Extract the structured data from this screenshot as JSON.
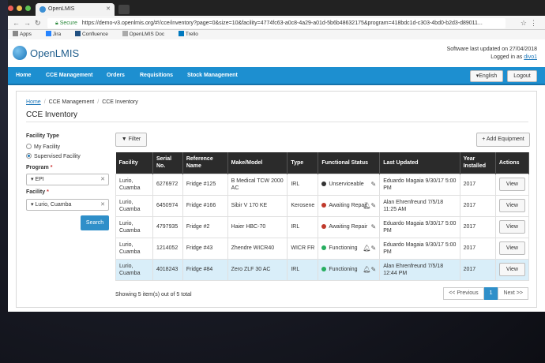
{
  "browser": {
    "tab_title": "OpenLMIS",
    "secure_label": "Secure",
    "url": "https://demo-v3.openlmis.org/#!/cce/inventory?page=0&size=10&facility=4774fc63-a0c8-4a29-a01d-5b6b48632175&program=418bdc1d-c303-4bd0-b2d3-d89011...",
    "bookmarks": [
      "Apps",
      "Jira",
      "Confluence",
      "OpenLMIS Doc",
      "Trello"
    ]
  },
  "header": {
    "logo_text": "OpenLMIS",
    "sync_text": "Software last updated on 27/04/2018",
    "logged_in_prefix": "Logged in as",
    "username": "divo1"
  },
  "nav": {
    "items": [
      "Home",
      "CCE Management",
      "Orders",
      "Requisitions",
      "Stock Management"
    ],
    "language": "▾English",
    "logout": "Logout"
  },
  "breadcrumbs": [
    "Home",
    "CCE Management",
    "CCE Inventory"
  ],
  "page_title": "CCE Inventory",
  "filters": {
    "facility_type_label": "Facility Type",
    "option_my": "My Facility",
    "option_supervised": "Supervised Facility",
    "program_label": "Program",
    "program_value": "EPI",
    "facility_label": "Facility",
    "facility_value": "Lurio, Cuamba",
    "search": "Search",
    "filter_button": "Filter",
    "add_button": "Add Equipment"
  },
  "table": {
    "headers": [
      "Facility",
      "Serial No.",
      "Reference Name",
      "Make/Model",
      "Type",
      "Functional Status",
      "Last Updated",
      "Year Installed",
      "Actions"
    ],
    "rows": [
      {
        "facility": "Lurio, Cuamba",
        "serial": "6276972",
        "ref": "Fridge #125",
        "model": "B Medical TCW 2000 AC",
        "type": "IRL",
        "status": "Unserviceable",
        "status_color": "#333333",
        "updated": "Eduardo Magaia 9/30/17 5:00 PM",
        "year": "2017",
        "action": "View"
      },
      {
        "facility": "Lurio, Cuamba",
        "serial": "6450974",
        "ref": "Fridge #166",
        "model": "Sibir V 170 KE",
        "type": "Kerosene",
        "status": "Awaiting Repair",
        "status_color": "#c0392b",
        "updated": "Alan Ehrenfreund 7/5/18 11:25 AM",
        "year": "2017",
        "action": "View"
      },
      {
        "facility": "Lurio, Cuamba",
        "serial": "4797935",
        "ref": "Fridge #2",
        "model": "Haier HBC-70",
        "type": "IRL",
        "status": "Awaiting Repair",
        "status_color": "#c0392b",
        "updated": "Eduardo Magaia 9/30/17 5:00 PM",
        "year": "2017",
        "action": "View"
      },
      {
        "facility": "Lurio, Cuamba",
        "serial": "1214052",
        "ref": "Fridge #43",
        "model": "Zhendre WICR40",
        "type": "WICR FR",
        "status": "Functioning",
        "status_color": "#27ae60",
        "updated": "Eduardo Magaia 9/30/17 5:00 PM",
        "year": "2017",
        "action": "View"
      },
      {
        "facility": "Lurio, Cuamba",
        "serial": "4018243",
        "ref": "Fridge #84",
        "model": "Zero ZLF 30 AC",
        "type": "IRL",
        "status": "Functioning",
        "status_color": "#27ae60",
        "updated": "Alan Ehrenfreund 7/5/18 12:44 PM",
        "year": "2017",
        "action": "View"
      }
    ]
  },
  "footer": {
    "showing": "Showing 5 item(s) out of 5 total",
    "prev": "<< Previous",
    "page": "1",
    "next": "Next >>"
  }
}
